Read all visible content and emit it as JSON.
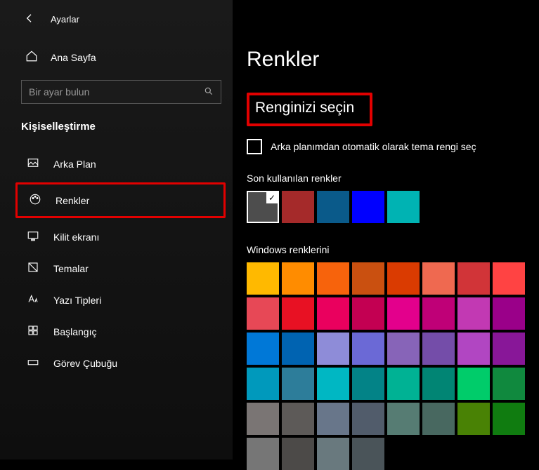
{
  "app_title": "Ayarlar",
  "home_label": "Ana Sayfa",
  "search": {
    "placeholder": "Bir ayar bulun"
  },
  "section_title": "Kişiselleştirme",
  "nav": {
    "background": "Arka Plan",
    "colors": "Renkler",
    "lockscreen": "Kilit ekranı",
    "themes": "Temalar",
    "fonts": "Yazı Tipleri",
    "start": "Başlangıç",
    "taskbar": "Görev Çubuğu"
  },
  "page_title": "Renkler",
  "choose_color_heading": "Renginizi seçin",
  "auto_checkbox_label": "Arka planımdan otomatik olarak tema rengi seç",
  "recent_label": "Son kullanılan renkler",
  "recent_colors": [
    "#4d4d4d",
    "#a52a2a",
    "#0a5a8a",
    "#0000ff",
    "#00b3b3"
  ],
  "recent_selected_index": 0,
  "grid_label": "Windows renklerini",
  "windows_colors": [
    "#ffb900",
    "#ff8c00",
    "#f7630c",
    "#ca5010",
    "#da3b01",
    "#ef6950",
    "#d13438",
    "#ff4343",
    "#e74856",
    "#e81123",
    "#ea005e",
    "#c30052",
    "#e3008c",
    "#bf0077",
    "#c239b3",
    "#9a0089",
    "#0078d7",
    "#0063b1",
    "#8e8cd8",
    "#6b69d6",
    "#8764b8",
    "#744da9",
    "#b146c2",
    "#881798",
    "#0099bc",
    "#2d7d9a",
    "#00b7c3",
    "#038387",
    "#00b294",
    "#018574",
    "#00cc6a",
    "#10893e",
    "#7a7574",
    "#5d5a58",
    "#68768a",
    "#515c6b",
    "#567c73",
    "#486860",
    "#498205",
    "#107c10",
    "#767676",
    "#4c4a48",
    "#69797e",
    "#4a5459"
  ],
  "highlight_color": "#e20000"
}
